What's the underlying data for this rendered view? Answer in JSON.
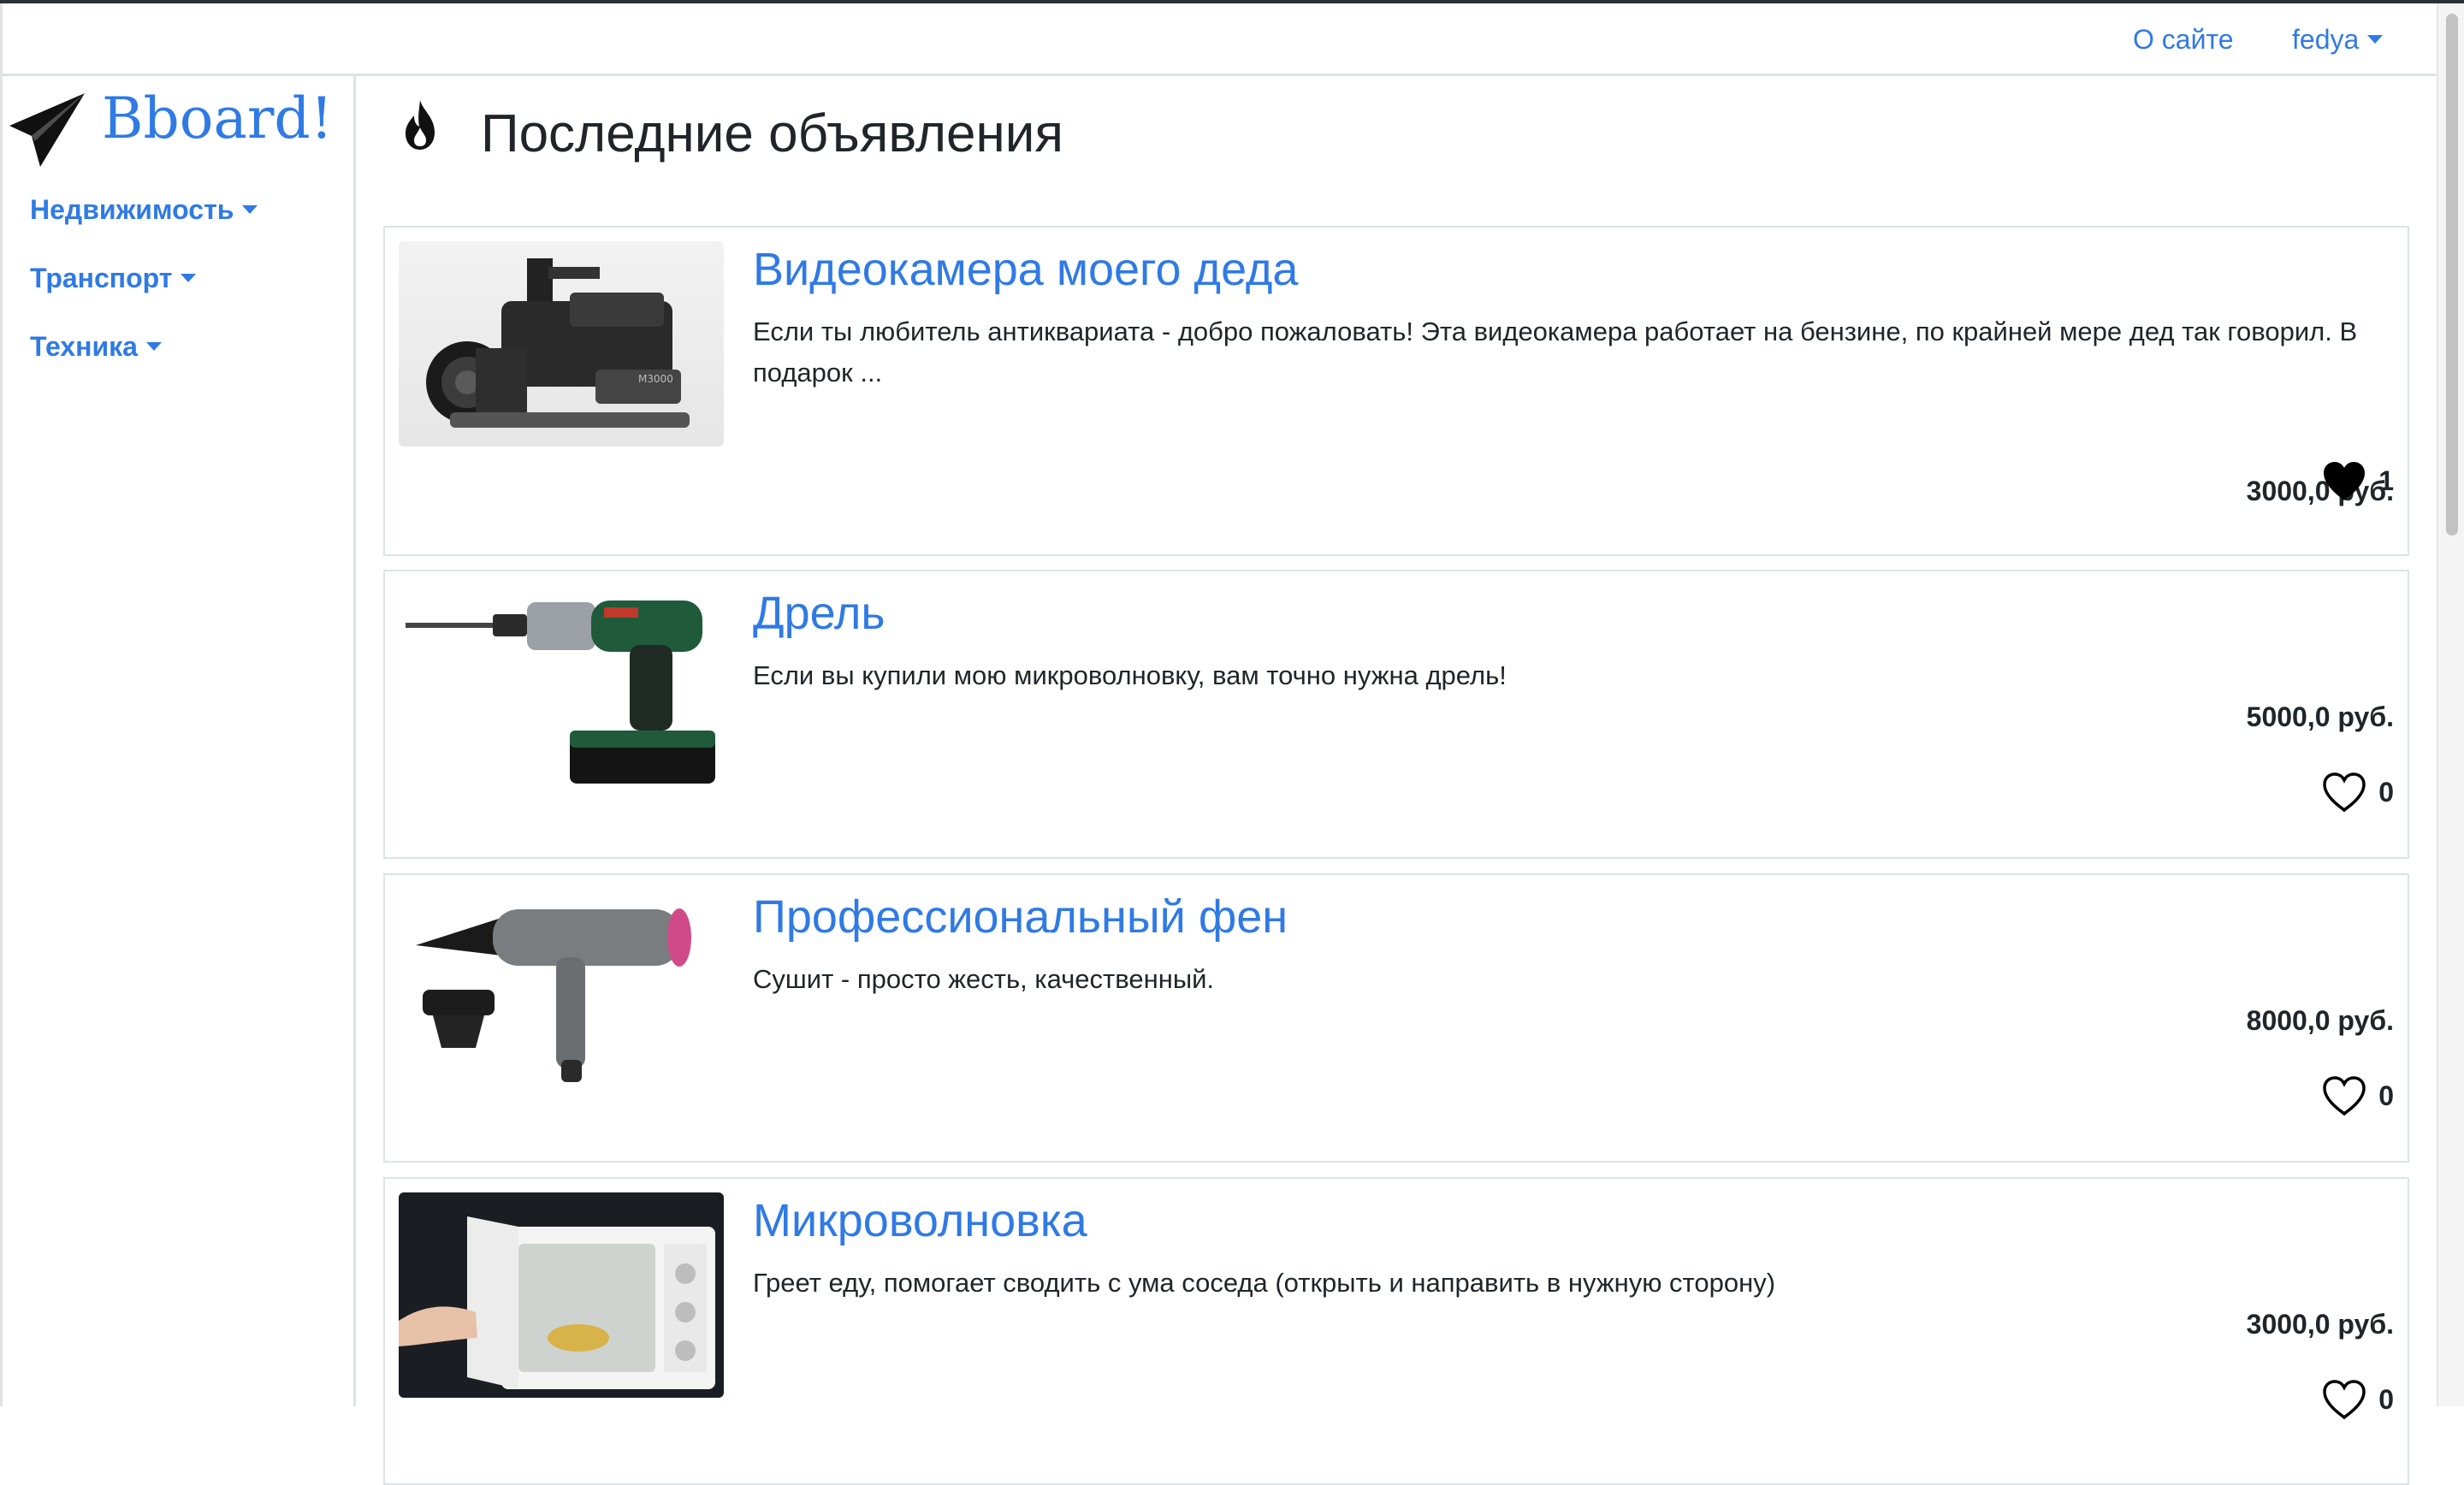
{
  "navbar": {
    "about_label": "О сайте",
    "user_label": "fedya"
  },
  "sidebar": {
    "logo_text": "Bboard!",
    "categories": [
      {
        "label": "Недвижимость"
      },
      {
        "label": "Транспорт"
      },
      {
        "label": "Техника"
      }
    ]
  },
  "main": {
    "page_title": "Последние объявления",
    "ads": [
      {
        "title": "Видеокамера моего деда",
        "description": "Если ты любитель антиквариата - добро пожаловать! Эта видеокамера работает на бензине, по крайней мере дед так говорил. В подарок ...",
        "price": "3000,0 руб.",
        "likes": "1",
        "liked": true,
        "image": "camcorder"
      },
      {
        "title": "Дрель",
        "description": "Если вы купили мою микроволновку, вам точно нужна дрель!",
        "price": "5000,0 руб.",
        "likes": "0",
        "liked": false,
        "image": "drill"
      },
      {
        "title": "Профессиональный фен",
        "description": "Сушит - просто жесть, качественный.",
        "price": "8000,0 руб.",
        "likes": "0",
        "liked": false,
        "image": "hair-dryer"
      },
      {
        "title": "Микроволновка",
        "description": "Греет еду, помогает сводить с ума соседа (открыть и направить в нужную сторону)",
        "price": "3000,0 руб.",
        "likes": "0",
        "liked": false,
        "image": "microwave"
      }
    ]
  },
  "colors": {
    "link": "#2f7ae5",
    "text": "#212529",
    "border": "#dee2e6"
  }
}
